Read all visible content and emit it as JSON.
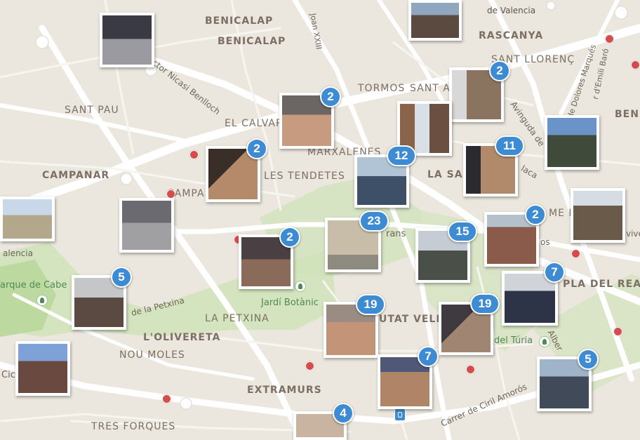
{
  "map": {
    "labels": {
      "de_valencia": "de Valencia",
      "benicalap1": "BENICALAP",
      "benicalap2": "BENICALAP",
      "rascanya": "RASCANYA",
      "sant_llorenc": "SANT LLORENÇ",
      "tormos": "TORMOS",
      "sant_a": "SANT A",
      "sant_pau": "SANT PAU",
      "el_calvari": "EL CALVAR",
      "marxalenes": "MARXALENES",
      "les_tendetes": "LES TENDETES",
      "la_sa": "LA SA",
      "campanar": "CAMPANAR",
      "campa": "CAMPA",
      "la_petxina": "LA PETXINA",
      "l_olivereta": "L'OLIVERETA",
      "nou_moles": "NOU MOLES",
      "extramurs": "EXTRAMURS",
      "tres_forques": "TRES FORQUES",
      "pla_del_real": "PLA DEL REA",
      "ciutat_vella": "UTAT VELL",
      "ben": "BEN",
      "jardi_botanic": "Jardí Botànic",
      "jardi_turia": "del Túria",
      "parque_cabecera": "arque de Cabe",
      "valencia_partial": "alencia",
      "avinguda_petxina": "de la Petxina",
      "doctor_nicasi": "Doctor Nicasi Benlloch",
      "joan_xxiii": "Joan XXIII",
      "avinguda_constitucio": "Avinguda de",
      "dolores_marques": "de Dolores Marqués",
      "emili_baro": "r d'Emili Baró",
      "ciril_amoros": "Carrer de Ciril Amorós",
      "trans": "rans",
      "alberes": "Alber",
      "vive": "vive",
      "rme": "ME R",
      "los": "os",
      "laca": "laca",
      "cic": "Cic"
    },
    "photos": [
      {
        "name": "photo-laptop",
        "badge": ""
      },
      {
        "name": "photo-group-top",
        "badge": ""
      },
      {
        "name": "photo-tower",
        "badge": "2"
      },
      {
        "name": "photo-selfie-three",
        "badge": "2"
      },
      {
        "name": "photo-arch",
        "badge": ""
      },
      {
        "name": "photo-group-bench",
        "badge": ""
      },
      {
        "name": "photo-selfie-two",
        "badge": "2"
      },
      {
        "name": "photo-group-12",
        "badge": "12"
      },
      {
        "name": "photo-wall-11",
        "badge": "11"
      },
      {
        "name": "photo-plaza-left",
        "badge": ""
      },
      {
        "name": "photo-stairs",
        "badge": ""
      },
      {
        "name": "photo-boy",
        "badge": ""
      },
      {
        "name": "photo-bus",
        "badge": "2"
      },
      {
        "name": "photo-building-23",
        "badge": "23"
      },
      {
        "name": "photo-crowd-15",
        "badge": "15"
      },
      {
        "name": "photo-station",
        "badge": "2"
      },
      {
        "name": "photo-trees-5",
        "badge": "5"
      },
      {
        "name": "photo-two-boys",
        "badge": "7"
      },
      {
        "name": "photo-selfie-19a",
        "badge": "19"
      },
      {
        "name": "photo-square-19b",
        "badge": "19"
      },
      {
        "name": "photo-group-left",
        "badge": ""
      },
      {
        "name": "photo-selfie-7",
        "badge": "7"
      },
      {
        "name": "photo-group-5",
        "badge": "5"
      },
      {
        "name": "photo-building-4",
        "badge": "4"
      }
    ]
  },
  "colors": {
    "badge": "#3d8bd3",
    "park": "#c9dfb2",
    "road": "#ffffff",
    "pin": "#d64c4c",
    "background": "#ebe7de"
  }
}
